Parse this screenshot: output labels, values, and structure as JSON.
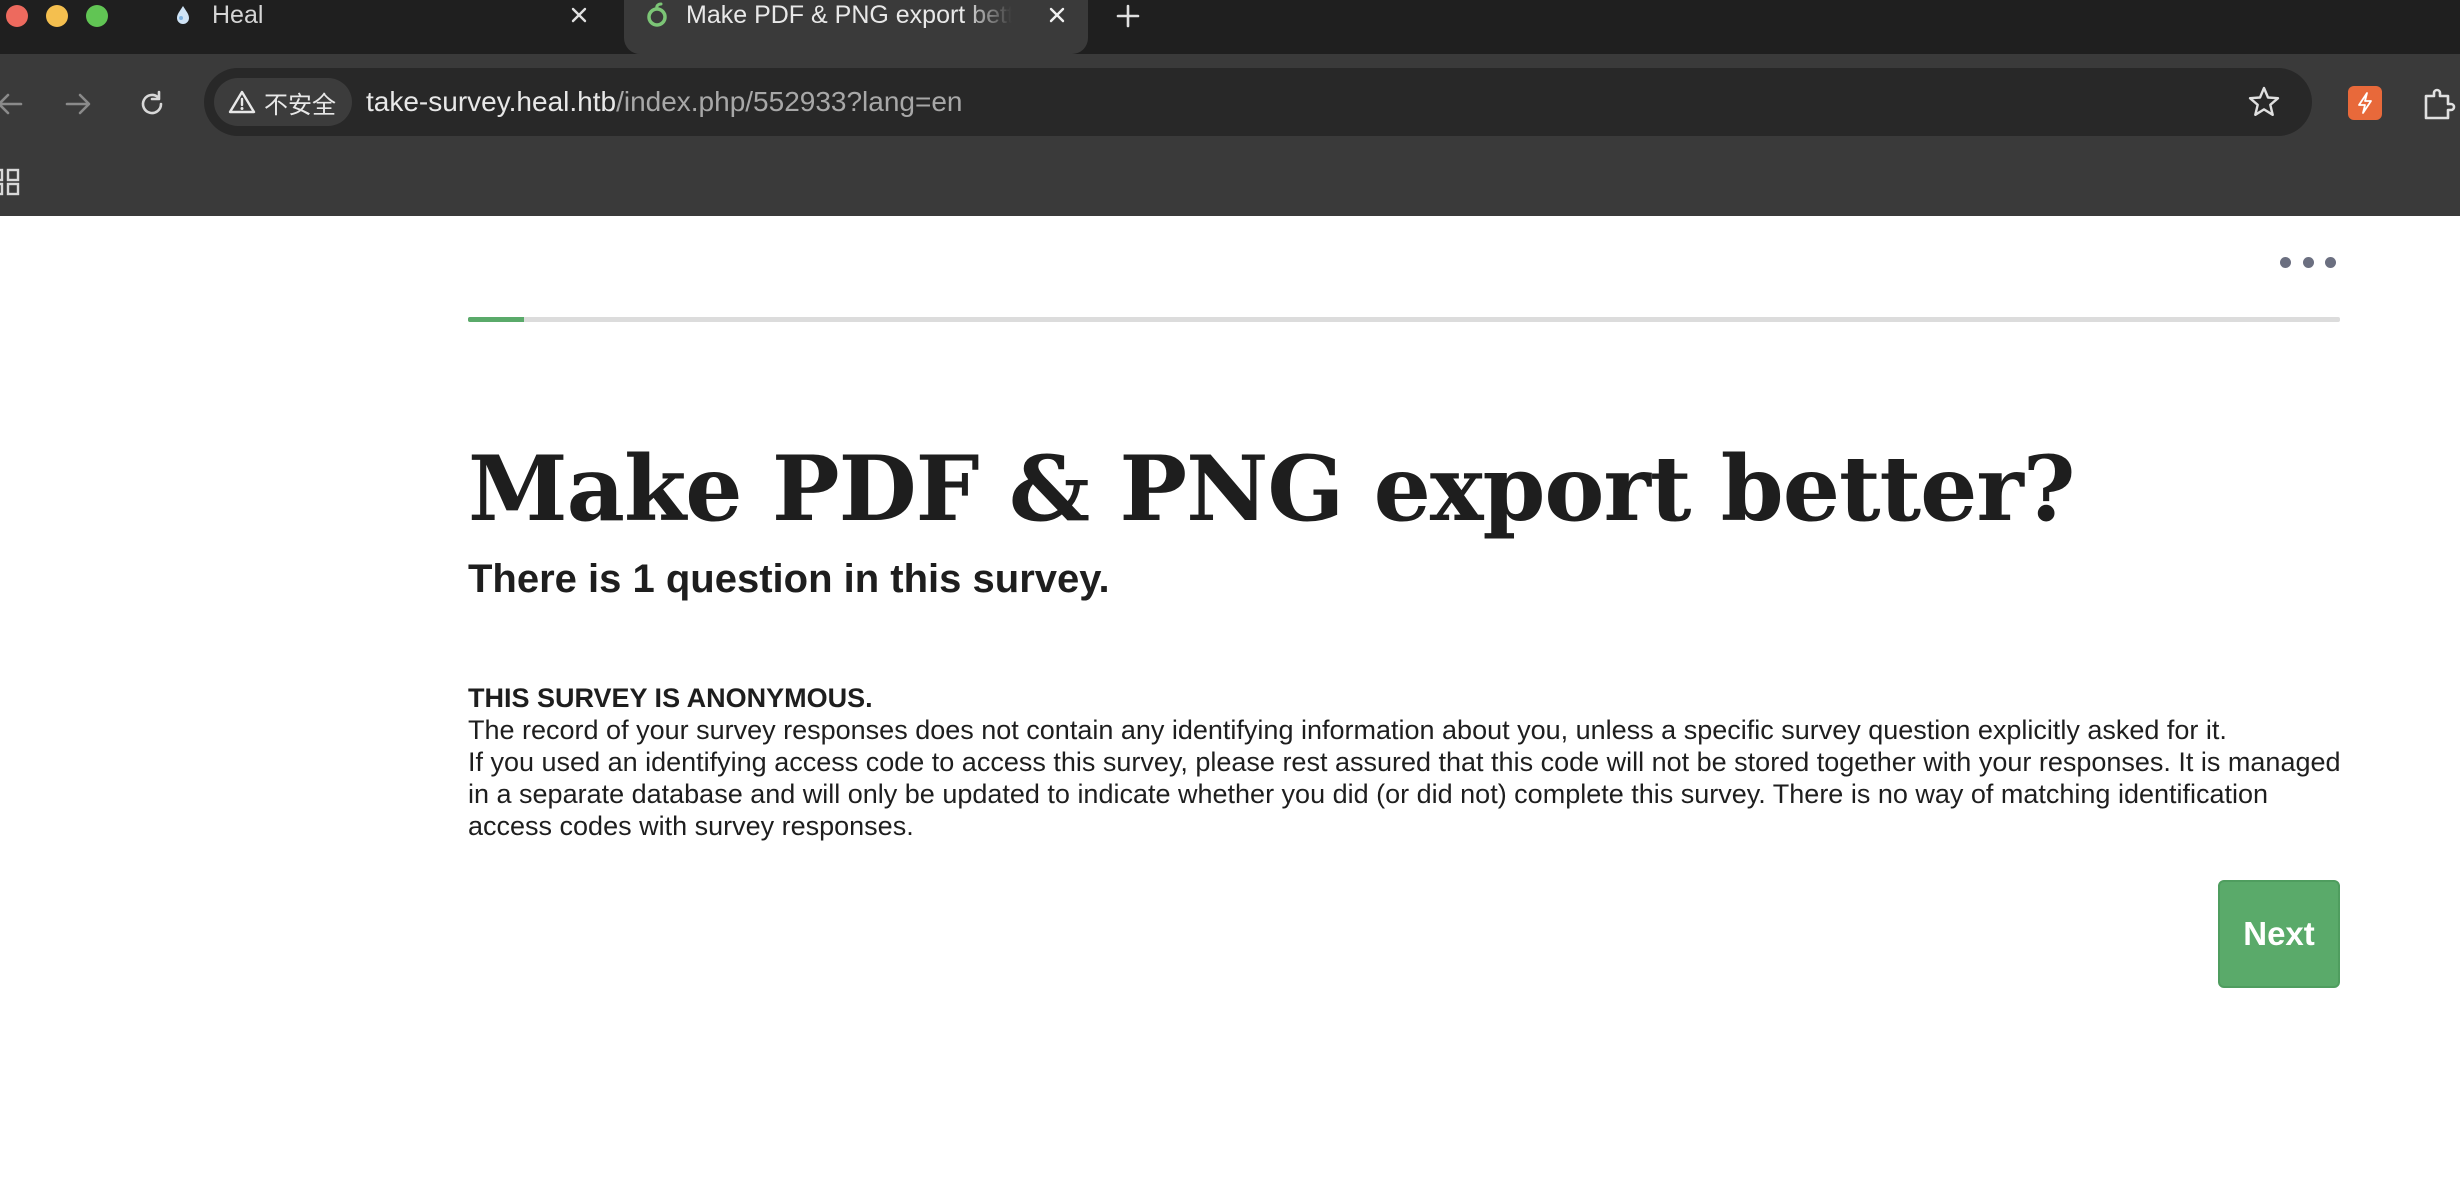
{
  "browser": {
    "tabs": [
      {
        "title": "Heal",
        "active": false,
        "favicon": "heal-drop-icon"
      },
      {
        "title": "Make PDF & PNG export bette",
        "active": true,
        "favicon": "limesurvey-icon"
      }
    ],
    "new_tab_icon": "plus-icon",
    "security_label": "不安全",
    "url_host": "take-survey.heal.htb",
    "url_path": "/index.php/552933?lang=en",
    "colors": {
      "chrome_dark": "#1f1f1f",
      "toolbar": "#3a3a3a",
      "omnibox": "#282828"
    }
  },
  "survey": {
    "progress_fraction": 0.03,
    "title": "Make PDF & PNG export better?",
    "question_count_text": "There is 1 question in this survey.",
    "privacy_heading": "THIS SURVEY IS ANONYMOUS.",
    "privacy_paragraph_1": "The record of your survey responses does not contain any identifying information about you, unless a specific survey question explicitly asked for it.",
    "privacy_paragraph_2": "If you used an identifying access code to access this survey, please rest assured that this code will not be stored together with your responses. It is man­aged in a separate database and will only be updated to indicate whether you did (or did not) complete this survey. There is no way of matching identifi­cation access codes with survey responses.",
    "next_label": "Next",
    "colors": {
      "accent": "#5aaa6a",
      "text": "#1e1e1e",
      "dots": "#6b6f80"
    }
  }
}
